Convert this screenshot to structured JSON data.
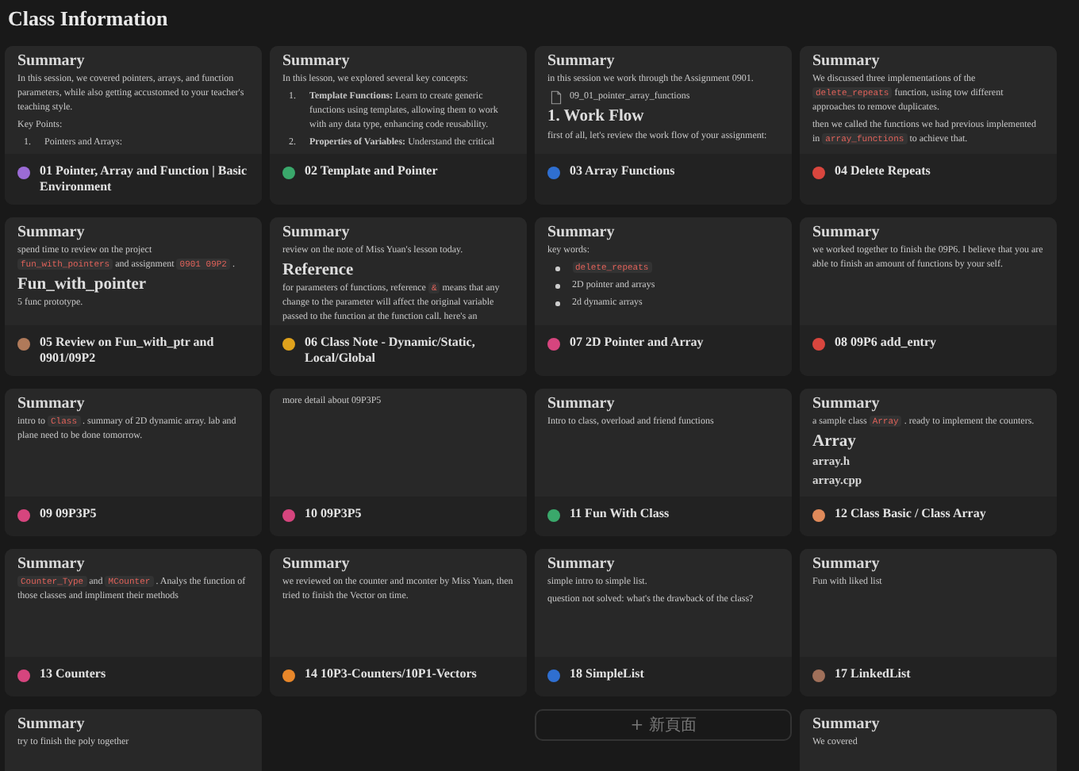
{
  "title": "Class Information",
  "cards": [
    {
      "title": "01 Pointer, Array and Function | Basic Environment",
      "color": "#9b6bd6",
      "preview": [
        {
          "kind": "heading",
          "parts": [
            {
              "text": "Summary",
              "code": false
            }
          ]
        },
        {
          "kind": "para",
          "parts": [
            {
              "text": "In this session, we covered pointers, arrays, and function parameters, while also getting accustomed to your teacher's teaching style.",
              "code": false
            }
          ]
        },
        {
          "kind": "para",
          "parts": [
            {
              "text": "Key Points:",
              "code": false
            }
          ]
        },
        {
          "kind": "num",
          "marker": "1.",
          "parts": [
            {
              "text": "Pointers and Arrays:",
              "code": false
            }
          ]
        }
      ]
    },
    {
      "title": "02 Template and Pointer",
      "color": "#3aa86b",
      "preview": [
        {
          "kind": "heading",
          "parts": [
            {
              "text": "Summary",
              "code": false
            }
          ]
        },
        {
          "kind": "para",
          "parts": [
            {
              "text": "In this lesson, we explored several key concepts:",
              "code": false
            }
          ]
        },
        {
          "kind": "num",
          "marker": "1.",
          "parts": [
            {
              "text": "**Template Functions:** Learn to create generic functions using templates, allowing them to work with any data type, enhancing code reusability.",
              "code": false
            }
          ]
        },
        {
          "kind": "num",
          "marker": "2.",
          "parts": [
            {
              "text": "**Properties of Variables:** Understand the critical",
              "code": false
            }
          ]
        }
      ]
    },
    {
      "title": "03 Array Functions",
      "color": "#2f6fd1",
      "preview": [
        {
          "kind": "heading",
          "parts": [
            {
              "text": "Summary",
              "code": false
            }
          ]
        },
        {
          "kind": "para",
          "parts": [
            {
              "text": "in this session we work through the Assignment 0901.",
              "code": false
            }
          ]
        },
        {
          "kind": "file",
          "parts": [
            {
              "text": "09_01_pointer_array_functions",
              "code": false
            }
          ]
        },
        {
          "kind": "h1",
          "parts": [
            {
              "text": "1. Work Flow",
              "code": false
            }
          ]
        },
        {
          "kind": "para",
          "parts": [
            {
              "text": "first of all, let's review the work flow of your assignment:",
              "code": false
            }
          ]
        }
      ]
    },
    {
      "title": "04 Delete Repeats",
      "color": "#d9463e",
      "preview": [
        {
          "kind": "heading",
          "parts": [
            {
              "text": "Summary",
              "code": false
            }
          ]
        },
        {
          "kind": "para",
          "parts": [
            {
              "text": "We discussed three implementations of the ",
              "code": false
            },
            {
              "text": "delete_repeats",
              "code": true
            },
            {
              "text": " function, using tow different approaches to remove duplicates.",
              "code": false
            }
          ]
        },
        {
          "kind": "para",
          "parts": [
            {
              "text": "then we called the functions we had previous implemented in ",
              "code": false
            },
            {
              "text": "array_functions",
              "code": true
            },
            {
              "text": " to achieve that.",
              "code": false
            }
          ]
        }
      ]
    },
    {
      "title": "05 Review on Fun_with_ptr and 0901/09P2",
      "color": "#b07a5a",
      "preview": [
        {
          "kind": "heading",
          "parts": [
            {
              "text": "Summary",
              "code": false
            }
          ]
        },
        {
          "kind": "para",
          "parts": [
            {
              "text": "spend time to review on the project ",
              "code": false
            },
            {
              "text": "fun_with_pointers",
              "code": true
            },
            {
              "text": " and assignment ",
              "code": false
            },
            {
              "text": "0901 09P2",
              "code": true
            },
            {
              "text": " .",
              "code": false
            }
          ]
        },
        {
          "kind": "h1",
          "parts": [
            {
              "text": "Fun_with_pointer",
              "code": false
            }
          ]
        },
        {
          "kind": "para",
          "parts": [
            {
              "text": "5 func prototype.",
              "code": false
            }
          ]
        }
      ]
    },
    {
      "title": "06 Class Note - Dynamic/Static, Local/Global",
      "color": "#e0a21c",
      "preview": [
        {
          "kind": "heading",
          "parts": [
            {
              "text": "Summary",
              "code": false
            }
          ]
        },
        {
          "kind": "para",
          "parts": [
            {
              "text": "review on the note of Miss Yuan's lesson today.",
              "code": false
            }
          ]
        },
        {
          "kind": "h1",
          "parts": [
            {
              "text": "Reference",
              "code": false
            }
          ]
        },
        {
          "kind": "para",
          "parts": [
            {
              "text": "for parameters of functions, reference ",
              "code": false
            },
            {
              "text": "&",
              "code": true
            },
            {
              "text": " means that any change to the parameter will affect the original variable passed to the function at  the function call. here's an",
              "code": false
            }
          ]
        }
      ]
    },
    {
      "title": "07 2D Pointer and Array",
      "color": "#d6457e",
      "preview": [
        {
          "kind": "heading",
          "parts": [
            {
              "text": "Summary",
              "code": false
            }
          ]
        },
        {
          "kind": "para",
          "parts": [
            {
              "text": "key words:",
              "code": false
            }
          ]
        },
        {
          "kind": "bullet",
          "parts": [
            {
              "text": "delete_repeats",
              "code": true
            }
          ]
        },
        {
          "kind": "bullet",
          "parts": [
            {
              "text": "2D pointer and arrays",
              "code": false
            }
          ]
        },
        {
          "kind": "bullet",
          "parts": [
            {
              "text": "2d dynamic arrays",
              "code": false
            }
          ]
        }
      ]
    },
    {
      "title": "08 09P6 add_entry",
      "color": "#d9463e",
      "preview": [
        {
          "kind": "heading",
          "parts": [
            {
              "text": "Summary",
              "code": false
            }
          ]
        },
        {
          "kind": "para",
          "parts": [
            {
              "text": "we worked together to finish the 09P6. I believe that you are able to finish an amount of functions by your self.",
              "code": false
            }
          ]
        }
      ]
    },
    {
      "title": "09 09P3P5",
      "color": "#d6457e",
      "preview": [
        {
          "kind": "heading",
          "parts": [
            {
              "text": "Summary",
              "code": false
            }
          ]
        },
        {
          "kind": "para",
          "parts": [
            {
              "text": "intro to ",
              "code": false
            },
            {
              "text": "Class",
              "code": true
            },
            {
              "text": " . summary of 2D dynamic array. lab and plane need to be done tomorrow.",
              "code": false
            }
          ]
        }
      ]
    },
    {
      "title": "10 09P3P5",
      "color": "#d6457e",
      "preview": [
        {
          "kind": "para",
          "parts": [
            {
              "text": "more detail about 09P3P5",
              "code": false
            }
          ]
        }
      ]
    },
    {
      "title": "11 Fun With Class",
      "color": "#3aa86b",
      "preview": [
        {
          "kind": "heading",
          "parts": [
            {
              "text": "Summary",
              "code": false
            }
          ]
        },
        {
          "kind": "para",
          "parts": [
            {
              "text": "Intro to class, overload and friend functions",
              "code": false
            }
          ]
        }
      ]
    },
    {
      "title": "12 Class Basic / Class Array",
      "color": "#e08a5a",
      "preview": [
        {
          "kind": "heading",
          "parts": [
            {
              "text": "Summary",
              "code": false
            }
          ]
        },
        {
          "kind": "para",
          "parts": [
            {
              "text": "a sample class ",
              "code": false
            },
            {
              "text": "Array",
              "code": true
            },
            {
              "text": " . ready to implement the counters.",
              "code": false
            }
          ]
        },
        {
          "kind": "h1",
          "parts": [
            {
              "text": "Array",
              "code": false
            }
          ]
        },
        {
          "kind": "h3",
          "parts": [
            {
              "text": "array.h",
              "code": false
            }
          ]
        },
        {
          "kind": "h3",
          "parts": [
            {
              "text": "array.cpp",
              "code": false
            }
          ]
        }
      ]
    },
    {
      "title": "13 Counters",
      "color": "#d6457e",
      "preview": [
        {
          "kind": "heading",
          "parts": [
            {
              "text": "Summary",
              "code": false
            }
          ]
        },
        {
          "kind": "para",
          "parts": [
            {
              "text": "Counter_Type",
              "code": true
            },
            {
              "text": " and ",
              "code": false
            },
            {
              "text": "MCounter",
              "code": true
            },
            {
              "text": " . Analys the function of those classes and impliment their methods",
              "code": false
            }
          ]
        }
      ]
    },
    {
      "title": "14 10P3-Counters/10P1-Vectors",
      "color": "#e8872a",
      "preview": [
        {
          "kind": "heading",
          "parts": [
            {
              "text": "Summary",
              "code": false
            }
          ]
        },
        {
          "kind": "para",
          "parts": [
            {
              "text": "we reviewed on the counter and mconter by Miss Yuan, then tried to finish the Vector on time.",
              "code": false
            }
          ]
        }
      ]
    },
    {
      "title": "18 SimpleList",
      "color": "#2f6fd1",
      "preview": [
        {
          "kind": "heading",
          "parts": [
            {
              "text": "Summary",
              "code": false
            }
          ]
        },
        {
          "kind": "para",
          "parts": [
            {
              "text": "simple intro to simple list.",
              "code": false
            }
          ]
        },
        {
          "kind": "para",
          "parts": [
            {
              "text": "question not solved: what's the drawback of the class?",
              "code": false
            }
          ]
        }
      ]
    },
    {
      "title": "17 LinkedList",
      "color": "#a0705a",
      "preview": [
        {
          "kind": "heading",
          "parts": [
            {
              "text": "Summary",
              "code": false
            }
          ]
        },
        {
          "kind": "para",
          "parts": [
            {
              "text": "Fun with liked list",
              "code": false
            }
          ]
        }
      ]
    },
    {
      "preview": [
        {
          "kind": "heading",
          "parts": [
            {
              "text": "Summary",
              "code": false
            }
          ]
        },
        {
          "kind": "para",
          "parts": [
            {
              "text": "try to finish the poly together",
              "code": false
            }
          ]
        }
      ]
    },
    {
      "preview": [
        {
          "kind": "heading",
          "parts": [
            {
              "text": "Summary",
              "code": false
            }
          ]
        },
        {
          "kind": "para",
          "parts": [
            {
              "text": "We covered",
              "code": false
            }
          ]
        }
      ]
    }
  ],
  "new_page": {
    "icon": "+",
    "label": "新頁面"
  }
}
